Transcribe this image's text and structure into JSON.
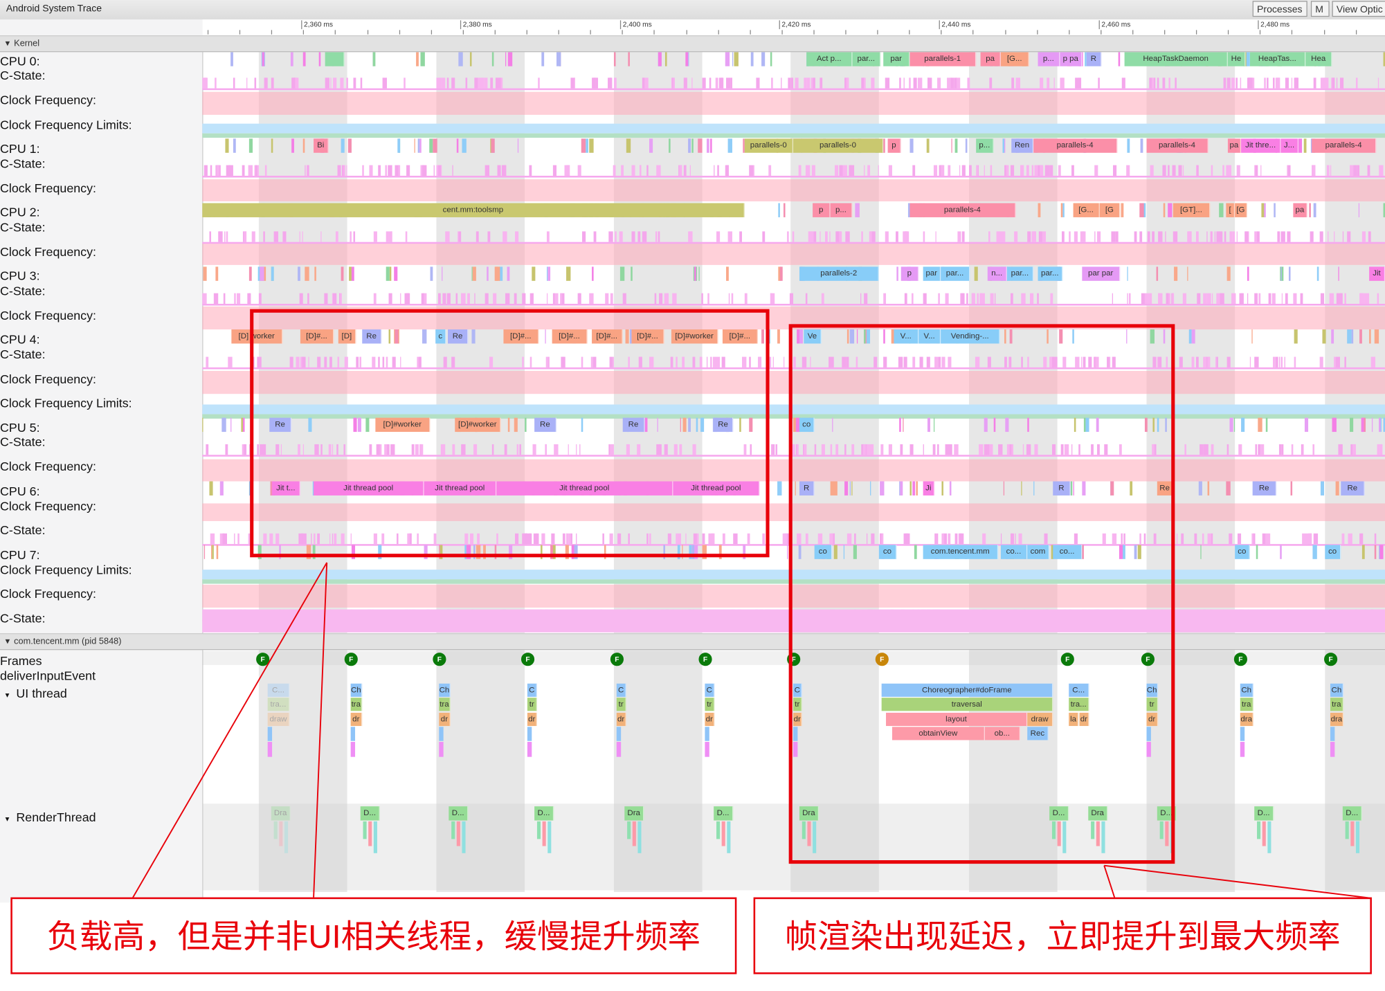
{
  "window": {
    "title": "Android System Trace",
    "buttons": [
      "Processes",
      "M",
      "View Optic"
    ]
  },
  "ruler": {
    "labels": [
      "2,360 ms",
      "2,380 ms",
      "2,400 ms",
      "2,420 ms",
      "2,440 ms",
      "2,460 ms",
      "2,480 ms"
    ]
  },
  "groups": {
    "kernel": "Kernel",
    "process": "com.tencent.mm (pid 5848)"
  },
  "track_labels": [
    "CPU 0:",
    "C-State:",
    "Clock Frequency:",
    "Clock Frequency Limits:",
    "CPU 1:",
    "C-State:",
    "Clock Frequency:",
    "CPU 2:",
    "C-State:",
    "Clock Frequency:",
    "CPU 3:",
    "C-State:",
    "Clock Frequency:",
    "CPU 4:",
    "C-State:",
    "Clock Frequency:",
    "Clock Frequency Limits:",
    "CPU 5:",
    "C-State:",
    "Clock Frequency:",
    "CPU 6:",
    "Clock Frequency:",
    "C-State:",
    "CPU 7:",
    "Clock Frequency Limits:",
    "Clock Frequency:",
    "C-State:"
  ],
  "process_tracks": {
    "frames": "Frames",
    "deliver": "deliverInputEvent",
    "ui": "UI thread",
    "render": "RenderThread"
  },
  "cpu_slices": {
    "cpu0": [
      "Act  p...",
      "par...",
      "par",
      "parallels-1",
      "pa",
      "[G...",
      "p...",
      "p pa",
      "R",
      "HeapTaskDaemon",
      "He",
      "HeapTas...",
      "Hea",
      ""
    ],
    "cpu1": [
      "Bi",
      "parallels-0",
      "parallels-0",
      "p",
      "p...",
      "Ren",
      "parallels-4",
      "parallels-4",
      "pa",
      "Jit thre...",
      "J...",
      "parallels-4"
    ],
    "cpu2": [
      "cent.mm:toolsmp",
      "p",
      "p...",
      "parallels-4",
      "[G...",
      "[G",
      "[GT]...",
      "[",
      "[G",
      "pa"
    ],
    "cpu3": [
      "parallels-2",
      "p",
      "par",
      "par...",
      "n...",
      "par...",
      "par...",
      "par par",
      "Jit"
    ],
    "cpu4": [
      "[D] worker",
      "[D]#...",
      "[D]",
      "Re",
      "c",
      "Re",
      "[D]#...",
      "[D]#...",
      "[D]#...",
      "[D]#...",
      "[D]#worker",
      "[D]#...",
      "Ve",
      "V...",
      "V...",
      "Vending-..."
    ],
    "cpu5": [
      "Re",
      "[D]#worker",
      "[D]#worker",
      "Re",
      "Re",
      "Re",
      "co"
    ],
    "cpu6": [
      "Jit t...",
      "Jit thread pool",
      "Jit thread pool",
      "Jit thread pool",
      "Jit thread pool",
      "R",
      "Ji",
      "R",
      "Re",
      "Re",
      "Re"
    ],
    "cpu7": [
      "co",
      "co",
      "com.tencent.mm",
      "co...",
      "com",
      "co...",
      "co",
      "co"
    ]
  },
  "frames": {
    "markers": [
      "F",
      "F",
      "F",
      "F",
      "F",
      "F",
      "F",
      "F",
      "F",
      "F",
      "F",
      "F"
    ],
    "status": [
      "good",
      "good",
      "good",
      "good",
      "good",
      "good",
      "good",
      "janky",
      "good",
      "good",
      "good",
      "good"
    ]
  },
  "ui_thread_slices": [
    "C...",
    "tra...",
    "draw",
    "Ch",
    "tra",
    "dr",
    "Ch",
    "tra",
    "dr",
    "C",
    "tr",
    "dr",
    "C",
    "tr",
    "dr",
    "C",
    "tr",
    "dr",
    "C",
    "tr",
    "dr",
    "Choreographer#doFrame",
    "traversal",
    "layout",
    "draw",
    "obtainView",
    "ob...",
    "Rec",
    "C...",
    "tra...",
    "la",
    "dr",
    "Ch",
    "tr",
    "dr",
    "Ch",
    "tra",
    "dra",
    "Ch",
    "tra",
    "dra"
  ],
  "render_thread_slices": [
    "Dra",
    "D...",
    "D...",
    "D...",
    "Dra",
    "D...",
    "Dra",
    "D...",
    "Dra",
    "D...",
    "D...",
    "D..."
  ],
  "annotations": {
    "left": "负载高，但是并非UI相关线程，缓慢提升频率",
    "right": "帧渲染出现延迟，立即提升到最大频率"
  },
  "colors": {
    "annotation": "#e8000a",
    "frame_good": "#0a7a0a",
    "frame_janky": "#c8860a"
  }
}
